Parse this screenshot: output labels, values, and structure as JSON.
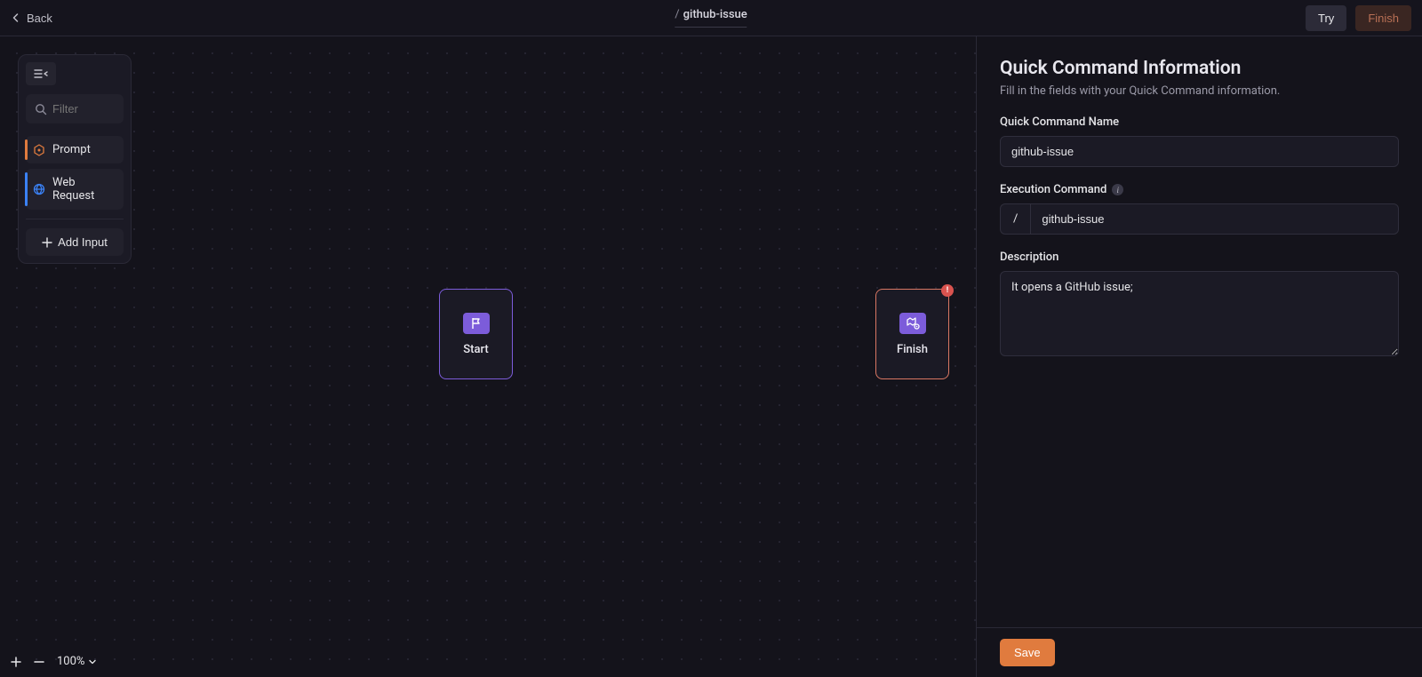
{
  "header": {
    "back_label": "Back",
    "title_slash": "/",
    "title_name": "github-issue",
    "try_label": "Try",
    "finish_label": "Finish"
  },
  "palette": {
    "filter_placeholder": "Filter",
    "items": {
      "prompt": "Prompt",
      "web_request": "Web Request"
    },
    "add_input_label": "Add Input"
  },
  "nodes": {
    "start": "Start",
    "finish": "Finish"
  },
  "zoom": {
    "level": "100%"
  },
  "panel": {
    "title": "Quick Command Information",
    "subtitle": "Fill in the fields with your Quick Command information.",
    "name_label": "Quick Command Name",
    "name_value": "github-issue",
    "exec_label": "Execution Command",
    "exec_prefix": "/",
    "exec_value": "github-issue",
    "description_label": "Description",
    "description_value": "It opens a GitHub issue;",
    "save_label": "Save"
  }
}
